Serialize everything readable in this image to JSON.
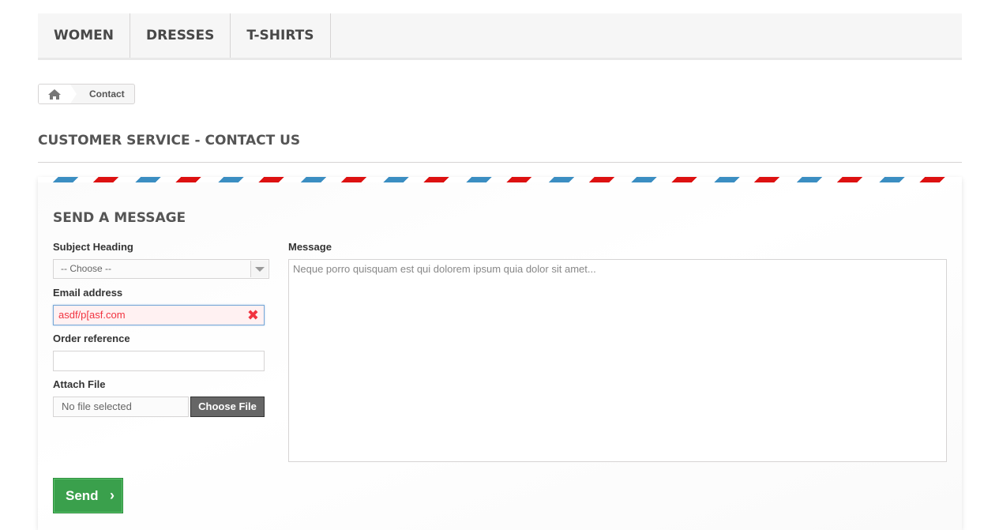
{
  "menu": {
    "items": [
      {
        "label": "WOMEN"
      },
      {
        "label": "DRESSES"
      },
      {
        "label": "T-SHIRTS"
      }
    ]
  },
  "breadcrumb": {
    "home_icon": "home-icon",
    "current": "Contact"
  },
  "page": {
    "heading": "CUSTOMER SERVICE - CONTACT US"
  },
  "form": {
    "title": "SEND A MESSAGE",
    "subject_label": "Subject Heading",
    "subject_value": "-- Choose --",
    "email_label": "Email address",
    "email_value": "asdf/p[asf.com",
    "email_error_icon": "✖",
    "order_label": "Order reference",
    "order_value": "",
    "attach_label": "Attach File",
    "file_status": "No file selected",
    "file_button": "Choose File",
    "message_label": "Message",
    "message_placeholder": "Neque porro quisquam est qui dolorem ipsum quia dolor sit amet...",
    "send_label": "Send",
    "send_icon": "›"
  },
  "colors": {
    "send_button": "#3aa04c",
    "error_text": "#f13340",
    "stripe_red": "#dd1111",
    "stripe_blue": "#3b8ec2"
  }
}
